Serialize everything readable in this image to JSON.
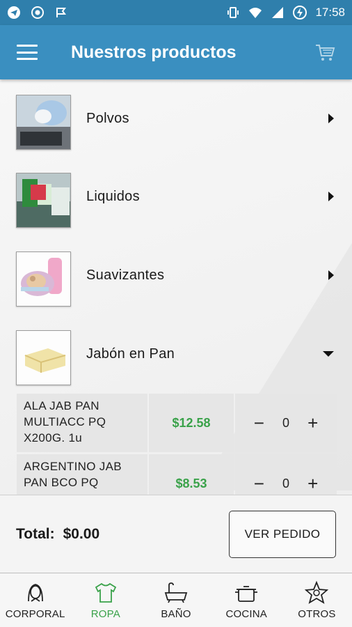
{
  "status_bar": {
    "time": "17:58"
  },
  "app_bar": {
    "title": "Nuestros productos"
  },
  "categories": [
    {
      "label": "Polvos",
      "expanded": false
    },
    {
      "label": "Liquidos",
      "expanded": false
    },
    {
      "label": "Suavizantes",
      "expanded": false
    },
    {
      "label": "Jabón en Pan",
      "expanded": true
    }
  ],
  "products": [
    {
      "name": "ALA JAB PAN MULTIACC PQ X200G. 1u",
      "price": "$12.58",
      "qty": "0"
    },
    {
      "name": "ARGENTINO JAB PAN BCO PQ",
      "price": "$8.53",
      "qty": "0"
    }
  ],
  "qty_controls": {
    "minus": "−",
    "plus": "+"
  },
  "footer": {
    "total_label": "Total:",
    "total_value": "$0.00",
    "button_label": "VER PEDIDO"
  },
  "nav": [
    {
      "label": "CORPORAL",
      "icon": "person-icon",
      "active": false
    },
    {
      "label": "ROPA",
      "icon": "shirt-icon",
      "active": true
    },
    {
      "label": "BAÑO",
      "icon": "bathtub-icon",
      "active": false
    },
    {
      "label": "COCINA",
      "icon": "pot-icon",
      "active": false
    },
    {
      "label": "OTROS",
      "icon": "star-icon",
      "active": false
    }
  ],
  "colors": {
    "primary": "#3a8fc0",
    "status_bar": "#2f7fac",
    "price_green": "#3aa24a",
    "active_nav": "#3aa24a"
  }
}
